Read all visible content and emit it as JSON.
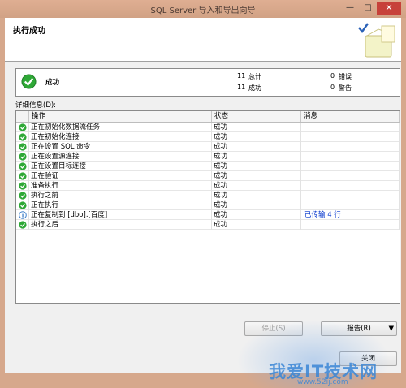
{
  "window": {
    "title": "SQL Server 导入和导出向导"
  },
  "header": {
    "title": "执行成功"
  },
  "summary": {
    "status": "成功",
    "total_count": "11",
    "total_label": "总计",
    "success_count": "11",
    "success_label": "成功",
    "error_count": "0",
    "error_label": "错误",
    "warning_count": "0",
    "warning_label": "警告"
  },
  "details": {
    "label": "详细信息(D):",
    "columns": [
      "操作",
      "状态",
      "消息"
    ],
    "rows": [
      {
        "icon": "success-icon",
        "operation": "正在初始化数据流任务",
        "status": "成功",
        "message": ""
      },
      {
        "icon": "success-icon",
        "operation": "正在初始化连接",
        "status": "成功",
        "message": ""
      },
      {
        "icon": "success-icon",
        "operation": "正在设置 SQL 命令",
        "status": "成功",
        "message": ""
      },
      {
        "icon": "success-icon",
        "operation": "正在设置源连接",
        "status": "成功",
        "message": ""
      },
      {
        "icon": "success-icon",
        "operation": "正在设置目标连接",
        "status": "成功",
        "message": ""
      },
      {
        "icon": "success-icon",
        "operation": "正在验证",
        "status": "成功",
        "message": ""
      },
      {
        "icon": "success-icon",
        "operation": "准备执行",
        "status": "成功",
        "message": ""
      },
      {
        "icon": "success-icon",
        "operation": "执行之前",
        "status": "成功",
        "message": ""
      },
      {
        "icon": "success-icon",
        "operation": "正在执行",
        "status": "成功",
        "message": ""
      },
      {
        "icon": "info-icon",
        "operation": "正在复制到 [dbo].[百度]",
        "status": "成功",
        "message": "已传输 4 行"
      },
      {
        "icon": "success-icon",
        "operation": "执行之后",
        "status": "成功",
        "message": ""
      }
    ]
  },
  "buttons": {
    "stop": "停止(S)",
    "report": "报告(R)",
    "close": "关闭"
  },
  "watermark": {
    "text": "我爱IT技术网",
    "url": "www.52ij.com"
  },
  "colors": {
    "success": "#2ea836",
    "info": "#3f7fc9",
    "link": "#0033cc"
  }
}
